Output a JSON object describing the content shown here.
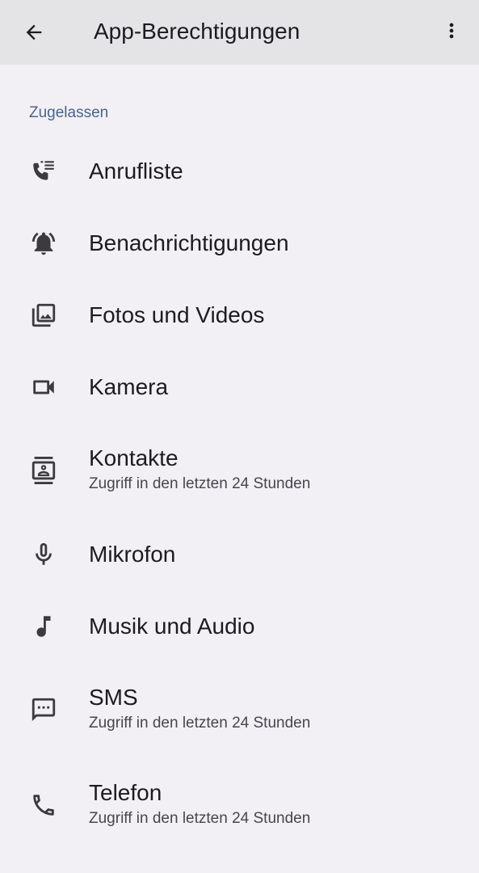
{
  "header": {
    "title": "App-Berechtigungen",
    "back_icon": "arrow-back-icon",
    "menu_icon": "more-vert-icon"
  },
  "section": {
    "title": "Zugelassen"
  },
  "permissions": [
    {
      "label": "Anrufliste",
      "sub": "",
      "icon": "call-log-icon"
    },
    {
      "label": "Benachrichtigungen",
      "sub": "",
      "icon": "notification-bell-icon"
    },
    {
      "label": "Fotos und Videos",
      "sub": "",
      "icon": "photo-library-icon"
    },
    {
      "label": "Kamera",
      "sub": "",
      "icon": "videocam-icon"
    },
    {
      "label": "Kontakte",
      "sub": "Zugriff in den letzten 24 Stunden",
      "icon": "contacts-icon"
    },
    {
      "label": "Mikrofon",
      "sub": "",
      "icon": "microphone-icon"
    },
    {
      "label": "Musik und Audio",
      "sub": "",
      "icon": "music-note-icon"
    },
    {
      "label": "SMS",
      "sub": "Zugriff in den letzten 24 Stunden",
      "icon": "sms-icon"
    },
    {
      "label": "Telefon",
      "sub": "Zugriff in den letzten 24 Stunden",
      "icon": "phone-icon"
    }
  ],
  "colors": {
    "background": "#f2f0f5",
    "topbar": "#e4e3e6",
    "section_header": "#4a6489",
    "icon": "#3b3a3e"
  }
}
